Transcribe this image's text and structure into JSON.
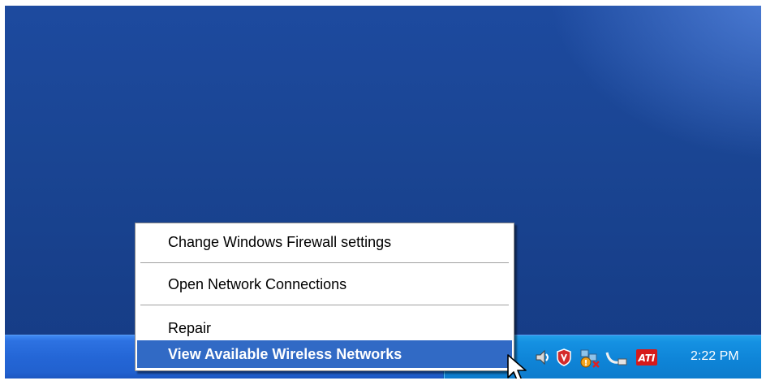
{
  "context_menu": {
    "items": [
      {
        "label": "Change Windows Firewall settings",
        "highlighted": false
      },
      {
        "label": "Open Network Connections",
        "highlighted": false
      },
      {
        "label": "Repair",
        "highlighted": false
      },
      {
        "label": "View Available Wireless Networks",
        "highlighted": true
      }
    ],
    "highlight_color": "#316ac5"
  },
  "taskbar": {
    "clock": "2:22 PM",
    "tray_icons": [
      "show-hidden-icons-chevron-icon",
      "wireless-network-icon",
      "volume-icon",
      "security-shield-icon",
      "network-alert-icon",
      "network-cable-icon",
      "ati-icon"
    ],
    "ati_label": "ATI",
    "taskbar_color": "#2466d6",
    "tray_color": "#0f85d8"
  },
  "desktop": {
    "background_color": "#1a4593"
  }
}
